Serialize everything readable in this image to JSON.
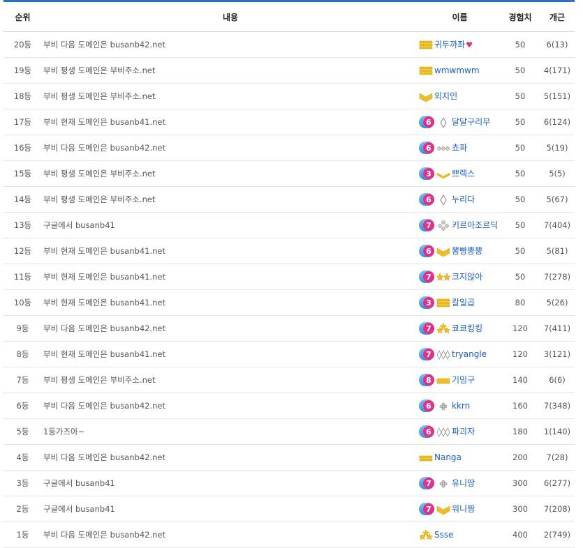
{
  "header": {
    "rank": "순위",
    "content": "내용",
    "name": "이름",
    "exp": "경험치",
    "count": "개근"
  },
  "colors": {
    "accent": "#2b6fc7",
    "name_link": "#1a5fc2",
    "level_ball": "#e0308a",
    "rank_gold": "#f2c218"
  },
  "rows": [
    {
      "rank": "20등",
      "content": "부비 다음 도메인은 busanb42.net",
      "level": "",
      "badge": "bars3",
      "name": "귀두까좌",
      "heart": "♥",
      "exp": "50",
      "count": "6(13)"
    },
    {
      "rank": "19등",
      "content": "부비 평생 도메인은 부비주소.net",
      "level": "",
      "badge": "bars3",
      "name": "wmwmwm",
      "exp": "50",
      "count": "4(171)"
    },
    {
      "rank": "18등",
      "content": "부비 평생 도메인은 부비주소.net",
      "level": "",
      "badge": "chevrons",
      "name": "외지인",
      "exp": "50",
      "count": "5(151)"
    },
    {
      "rank": "17등",
      "content": "부비 현재 도메인은 busanb41.net",
      "level": "6",
      "badge": "diamond1",
      "name": "달달구리무",
      "exp": "50",
      "count": "6(124)"
    },
    {
      "rank": "16등",
      "content": "부비 다음 도메인은 busanb42.net",
      "level": "6",
      "badge": "flowers3",
      "name": "쵸파",
      "exp": "50",
      "count": "5(19)"
    },
    {
      "rank": "15등",
      "content": "부비 평생 도메인은 부비주소.net",
      "level": "3",
      "badge": "chevron1",
      "name": "쁘렉스",
      "exp": "50",
      "count": "5(5)"
    },
    {
      "rank": "14등",
      "content": "부비 평생 도메인은 부비주소.net",
      "level": "6",
      "badge": "diamond1",
      "name": "누리다",
      "exp": "50",
      "count": "5(67)"
    },
    {
      "rank": "13등",
      "content": "구글에서 busanb41",
      "level": "7",
      "badge": "flowers4",
      "name": "키르아조르딕",
      "exp": "50",
      "count": "7(404)"
    },
    {
      "rank": "12등",
      "content": "부비 현재 도메인은 busanb41.net",
      "level": "6",
      "badge": "chevrons",
      "name": "뽕빵뿡뿡",
      "exp": "50",
      "count": "5(81)"
    },
    {
      "rank": "11등",
      "content": "부비 현재 도메인은 busanb41.net",
      "level": "7",
      "badge": "stars2",
      "name": "크지않아",
      "exp": "50",
      "count": "7(278)"
    },
    {
      "rank": "10등",
      "content": "부비 현재 도메인은 busanb41.net",
      "level": "3",
      "badge": "bars3",
      "name": "칼일곱",
      "exp": "80",
      "count": "5(26)"
    },
    {
      "rank": "9등",
      "content": "부비 다음 도메인은 busanb42.net",
      "level": "7",
      "badge": "stars3",
      "name": "쿄쿄킹킹",
      "exp": "120",
      "count": "7(411)"
    },
    {
      "rank": "8등",
      "content": "부비 현재 도메인은 busanb41.net",
      "level": "7",
      "badge": "diamond3",
      "name": "tryangle",
      "exp": "120",
      "count": "3(121)"
    },
    {
      "rank": "7등",
      "content": "부비 평생 도메인은 부비주소.net",
      "level": "8",
      "badge": "bars2",
      "name": "기밍구",
      "exp": "140",
      "count": "6(6)"
    },
    {
      "rank": "6등",
      "content": "부비 다음 도메인은 busanb42.net",
      "level": "6",
      "badge": "flower1",
      "name": "kkrn",
      "exp": "160",
      "count": "7(348)"
    },
    {
      "rank": "5등",
      "content": "1등가즈아~",
      "level": "6",
      "badge": "diamond3",
      "name": "파괴자",
      "exp": "180",
      "count": "1(140)"
    },
    {
      "rank": "4등",
      "content": "부비 다음 도메인은 busanb42.net",
      "level": "",
      "badge": "bars2",
      "name": "Nanga",
      "exp": "200",
      "count": "7(28)"
    },
    {
      "rank": "3등",
      "content": "구글에서 busanb41",
      "level": "7",
      "badge": "flower1",
      "name": "유니땅",
      "exp": "300",
      "count": "6(277)"
    },
    {
      "rank": "2등",
      "content": "구글에서 busanb41",
      "level": "7",
      "badge": "chevrons",
      "name": "워니짱",
      "exp": "300",
      "count": "7(208)"
    },
    {
      "rank": "1등",
      "content": "부비 다음 도메인은 busanb42.net",
      "level": "",
      "badge": "stars3",
      "name": "Ssse",
      "exp": "400",
      "count": "2(749)"
    }
  ]
}
